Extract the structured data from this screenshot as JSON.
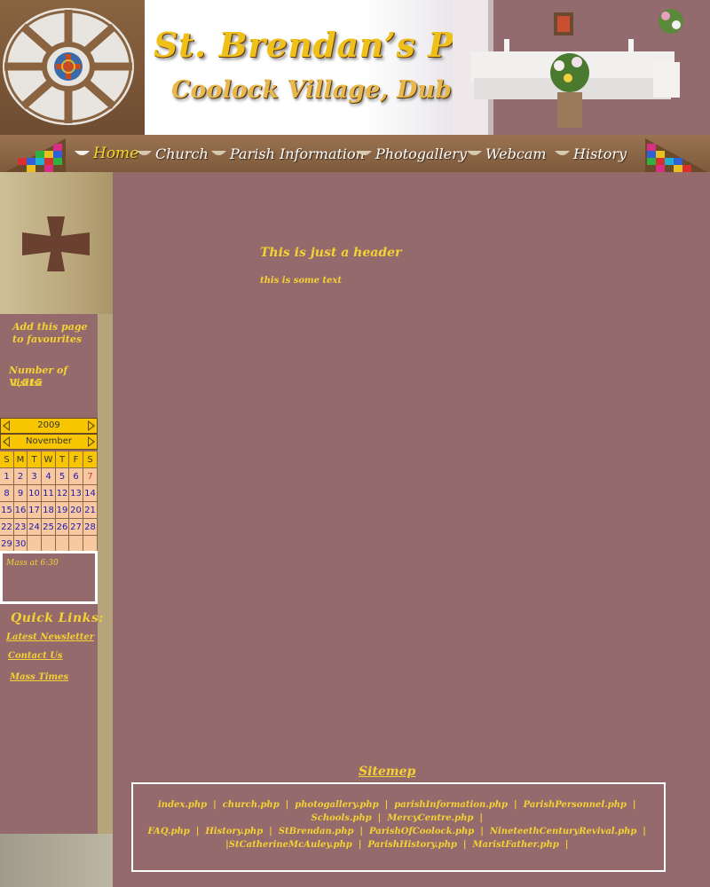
{
  "header": {
    "title": "St. Brendan’s Parish",
    "subtitle": "Coolock Village, Dublin."
  },
  "nav": {
    "items": [
      {
        "label": "Home",
        "active": true
      },
      {
        "label": "Church"
      },
      {
        "label": "Parish Information"
      },
      {
        "label": "Photogallery"
      },
      {
        "label": "Webcam"
      },
      {
        "label": "History"
      }
    ]
  },
  "sidebar": {
    "favourites": "Add this page to favourites",
    "visits_label": "Number of Visits:",
    "visits_count": "1,515",
    "calendar": {
      "year": "2009",
      "month": "November",
      "weekdays": [
        "S",
        "M",
        "T",
        "W",
        "T",
        "F",
        "S"
      ],
      "weeks": [
        [
          "1",
          "2",
          "3",
          "4",
          "5",
          "6",
          "7"
        ],
        [
          "8",
          "9",
          "10",
          "11",
          "12",
          "13",
          "14"
        ],
        [
          "15",
          "16",
          "17",
          "18",
          "19",
          "20",
          "21"
        ],
        [
          "22",
          "23",
          "24",
          "25",
          "26",
          "27",
          "28"
        ],
        [
          "29",
          "30",
          "",
          "",
          "",
          "",
          ""
        ]
      ],
      "highlighted_day": "7"
    },
    "event_text": "Mass at 6:30",
    "quick_links_title": "Quick Links:",
    "quick_links": [
      "Latest Newsletter",
      "Contact Us",
      "Mass Times"
    ]
  },
  "main": {
    "header": "This is just a header",
    "text": "this is some text"
  },
  "sitemap": {
    "title": "Sitemep",
    "lines": [
      [
        "index.php",
        "church.php",
        "photogallery.php",
        "parishInformation.php",
        "ParishPersonnel.php",
        "Schools.php",
        "MercyCentre.php"
      ],
      [
        "FAQ.php",
        "History.php",
        "StBrendan.php",
        "ParishOfCoolock.php",
        "NineteethCenturyRevival.php"
      ],
      [
        "StCatherineMcAuley.php",
        "ParishHistory.php",
        "MaristFather.php"
      ]
    ]
  },
  "colors": {
    "background": "#946a6c",
    "accent": "#f4d234",
    "title": "#f0c01a",
    "nav_bar": "#8a6440",
    "calendar_header": "#f8c600",
    "calendar_cell": "#f8c8a0"
  }
}
